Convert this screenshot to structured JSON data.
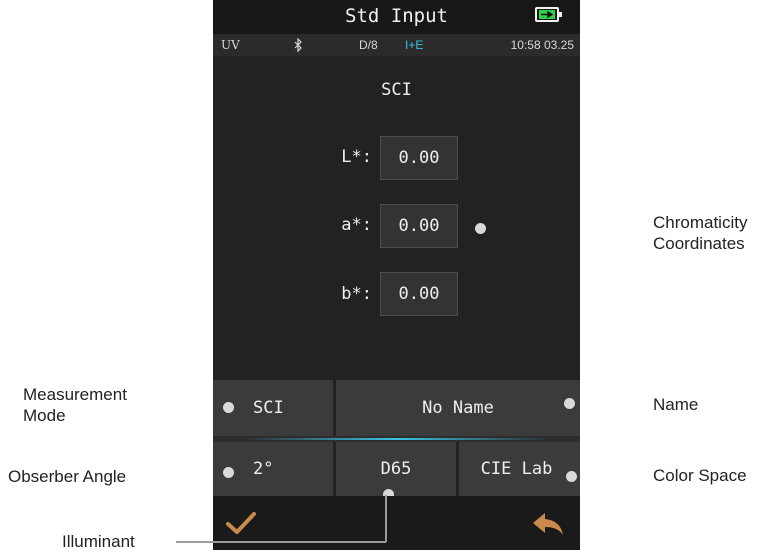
{
  "screen": {
    "title": "Std Input",
    "status": {
      "uv": "UV",
      "geometry": "D/8",
      "mode": "I+E",
      "time": "10:58 03.25"
    },
    "heading": "SCI",
    "fields": [
      {
        "label": "L*:",
        "value": "0.00"
      },
      {
        "label": "a*:",
        "value": "0.00"
      },
      {
        "label": "b*:",
        "value": "0.00"
      }
    ],
    "buttons": {
      "measurement_mode": "SCI",
      "name": "No Name",
      "observer_angle": "2°",
      "illuminant": "D65",
      "color_space": "CIE Lab"
    }
  },
  "annotations": {
    "chromaticity_line1": "Chromaticity",
    "chromaticity_line2": "Coordinates",
    "measurement_line1": "Measurement",
    "measurement_line2": "Mode",
    "name": "Name",
    "observer": "Obserber Angle",
    "color_space": "Color Space",
    "illuminant": "Illuminant"
  },
  "colors": {
    "accent_cyan": "#38c4e6",
    "confirm_icon": "#c98a4b",
    "back_icon": "#c98a4b",
    "battery_green": "#2fd04a"
  },
  "icons": [
    "battery-charging-icon",
    "bluetooth-icon",
    "confirm-check-icon",
    "back-arrow-icon"
  ]
}
